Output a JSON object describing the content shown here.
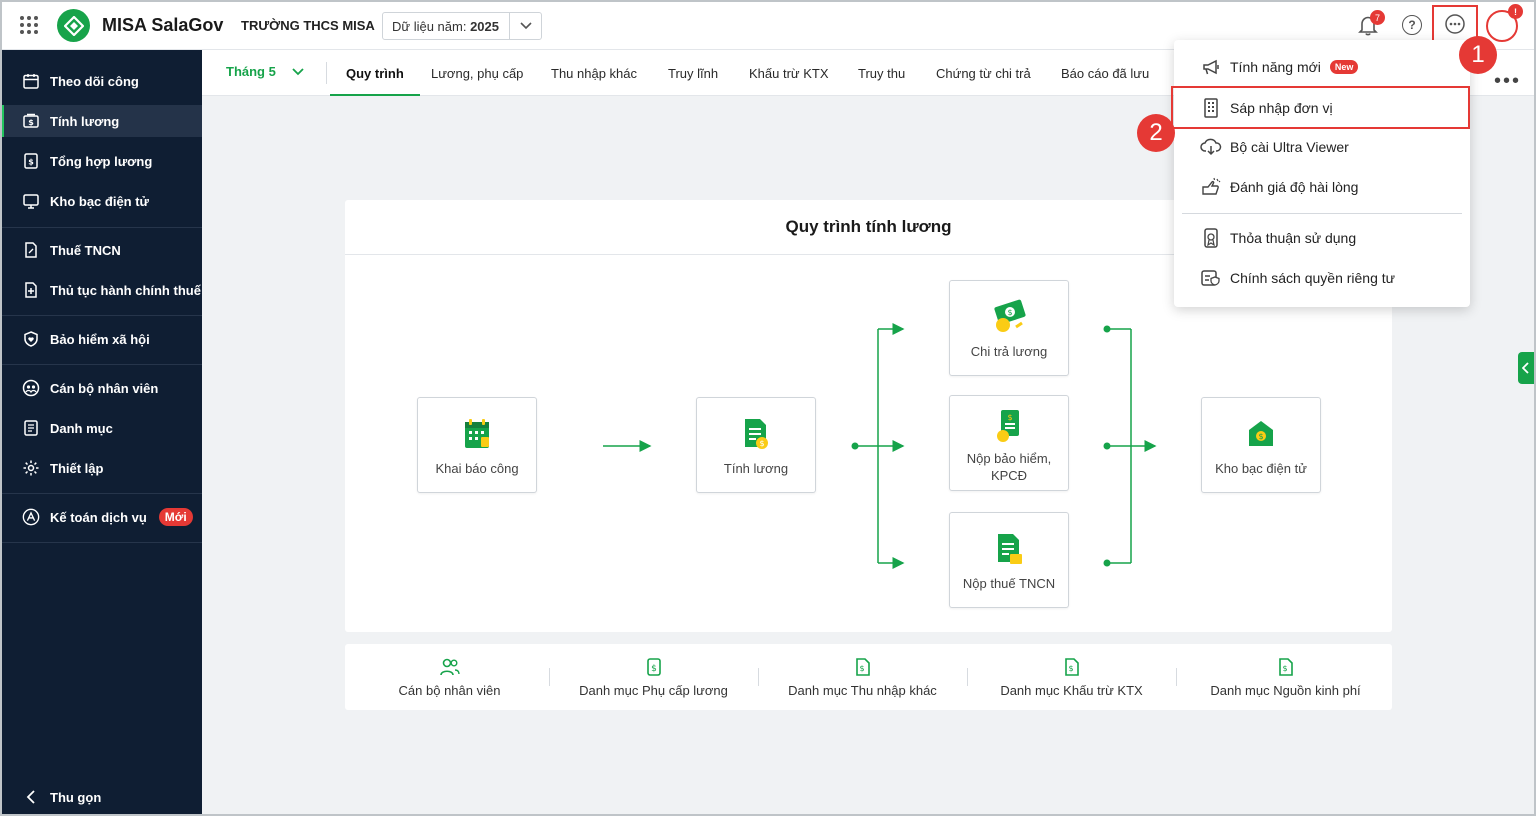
{
  "header": {
    "app_name": "MISA SalaGov",
    "school_name": "TRƯỜNG THCS MISA",
    "year_prefix": "Dữ liệu năm:",
    "year_value": "2025",
    "notification_count": "7",
    "avatar_badge": "!"
  },
  "callouts": {
    "one": "1",
    "two": "2"
  },
  "sidebar": {
    "items": [
      {
        "label": "Theo dõi công",
        "icon": "calendar-icon"
      },
      {
        "label": "Tính lương",
        "icon": "salary-icon"
      },
      {
        "label": "Tổng hợp lương",
        "icon": "document-money-icon"
      },
      {
        "label": "Kho bạc điện tử",
        "icon": "monitor-icon"
      },
      {
        "label": "Thuế TNCN",
        "icon": "tax-document-icon"
      },
      {
        "label": "Thủ tục hành chính thuế",
        "icon": "document-plus-icon"
      },
      {
        "label": "Bảo hiểm xã hội",
        "icon": "shield-heart-icon"
      },
      {
        "label": "Cán bộ nhân viên",
        "icon": "people-icon"
      },
      {
        "label": "Danh mục",
        "icon": "list-icon"
      },
      {
        "label": "Thiết lập",
        "icon": "gear-icon"
      },
      {
        "label": "Kế toán dịch vụ",
        "icon": "accounting-icon",
        "badge": "Mới"
      }
    ],
    "collapse_label": "Thu gọn"
  },
  "tabs": {
    "month": "Tháng 5",
    "items": [
      "Quy trình",
      "Lương, phụ cấp",
      "Thu nhập khác",
      "Truy lĩnh",
      "Khấu trừ KTX",
      "Truy thu",
      "Chứng từ chi trả",
      "Báo cáo đã lưu"
    ],
    "more": "•••"
  },
  "process": {
    "title": "Quy trình tính lương",
    "steps": [
      "Khai báo công",
      "Tính lương",
      "Chi trả lương",
      "Nộp bảo hiểm, KPCĐ",
      "Nộp thuế TNCN",
      "Kho bạc điện tử"
    ]
  },
  "quick_links": [
    "Cán bộ nhân viên",
    "Danh mục Phụ cấp lương",
    "Danh mục Thu nhập khác",
    "Danh mục Khấu trừ KTX",
    "Danh mục Nguồn kinh phí"
  ],
  "dropdown": {
    "items": [
      {
        "label": "Tính năng mới",
        "badge": "New",
        "icon": "megaphone-icon"
      },
      {
        "label": "Sáp nhập đơn vị",
        "icon": "building-icon"
      },
      {
        "label": "Bộ cài Ultra Viewer",
        "icon": "cloud-download-icon"
      },
      {
        "label": "Đánh giá độ hài lòng",
        "icon": "rating-icon"
      },
      {
        "label": "Thỏa thuận sử dụng",
        "icon": "agreement-icon"
      },
      {
        "label": "Chính sách quyền riêng tư",
        "icon": "privacy-icon"
      }
    ]
  },
  "colors": {
    "brand_green": "#16a34a",
    "sidebar_bg": "#0f1e33",
    "alert_red": "#e53935"
  }
}
